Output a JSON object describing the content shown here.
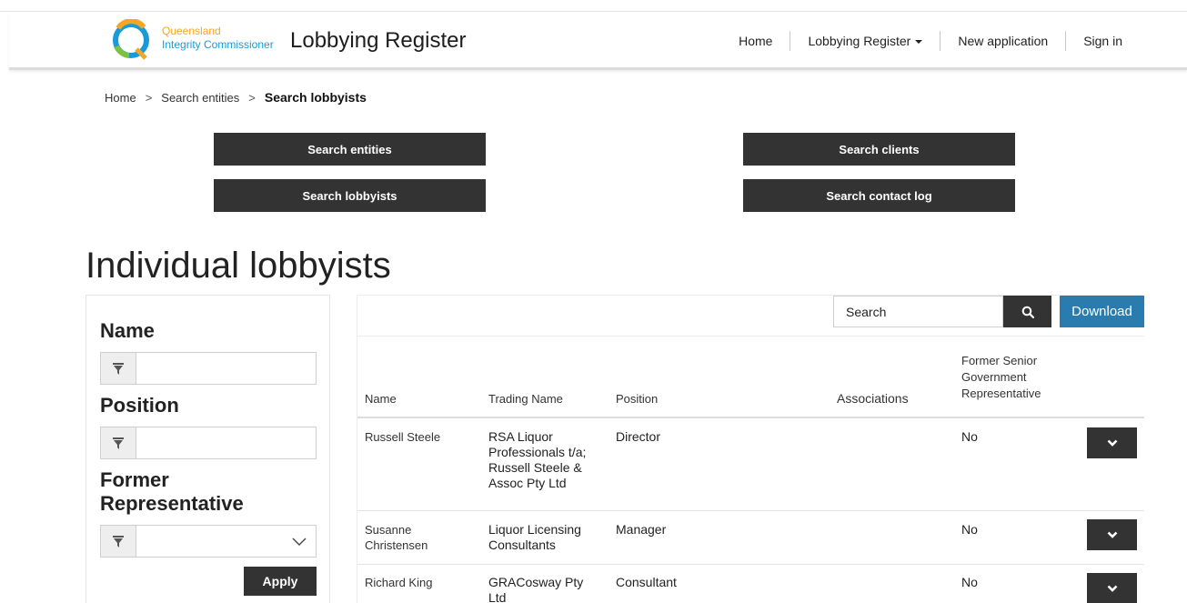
{
  "header": {
    "logo_line1": "Queensland",
    "logo_line2": "Integrity Commissioner",
    "site_title": "Lobbying Register",
    "nav": {
      "home": "Home",
      "register": "Lobbying Register",
      "new_application": "New application",
      "sign_in": "Sign in"
    }
  },
  "breadcrumb": {
    "home": "Home",
    "sep1": ">",
    "entities": "Search entities",
    "sep2": ">",
    "current": "Search lobbyists"
  },
  "search_buttons": {
    "entities": "Search entities",
    "clients": "Search clients",
    "lobbyists": "Search lobbyists",
    "contact_log": "Search contact log"
  },
  "page_title": "Individual lobbyists",
  "filters": {
    "name_label": "Name",
    "name_value": "",
    "position_label": "Position",
    "position_value": "",
    "former_label": "Former Representative",
    "former_value": "",
    "apply_label": "Apply"
  },
  "toolbar": {
    "search_placeholder": "Search",
    "download_label": "Download"
  },
  "table": {
    "columns": {
      "name": "Name",
      "trading_name": "Trading Name",
      "position": "Position",
      "associations": "Associations",
      "former": "Former Senior Government Representative"
    },
    "rows": [
      {
        "name": "Russell Steele",
        "trading_name": "RSA Liquor Professionals t/a; Russell Steele & Assoc Pty Ltd",
        "position": "Director",
        "associations": "",
        "former": "No"
      },
      {
        "name": "Susanne Christensen",
        "trading_name": "Liquor Licensing Consultants",
        "position": "Manager",
        "associations": "",
        "former": "No"
      },
      {
        "name": "Richard King",
        "trading_name": "GRACosway Pty Ltd",
        "position": "Consultant",
        "associations": "",
        "former": "No"
      }
    ]
  },
  "colors": {
    "dark_button": "#333333",
    "download_button": "#2b7cae",
    "logo_orange": "#f5a623",
    "logo_blue": "#1a9ad6"
  },
  "icons": {
    "filter": "filter-icon",
    "search": "search-icon",
    "expand": "chevron-down-icon",
    "select": "chevron-down-icon"
  }
}
